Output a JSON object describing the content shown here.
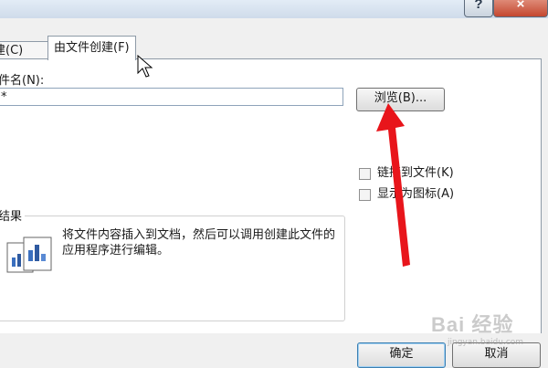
{
  "titlebar": {
    "help_icon": "?",
    "close_icon": "×"
  },
  "tabs": [
    {
      "label": "建(C)"
    },
    {
      "label": "由文件创建(F)",
      "active": true
    }
  ],
  "form": {
    "filename_label": "件名(N):",
    "filename_value": "*",
    "browse_label": "浏览(B)...",
    "link_label": "链接到文件(K)",
    "icon_label": "显示为图标(A)"
  },
  "result": {
    "label": "结果",
    "description": "将文件内容插入到文档，然后可以调用创建此文件的应用程序进行编辑。"
  },
  "footer": {
    "ok_label": "确定",
    "cancel_label": "取消"
  },
  "watermark": {
    "brand": "Bai 经验",
    "url": "jingyan.baidu.com"
  },
  "colors": {
    "arrow": "#e8151b",
    "close_button": "#c4472f"
  }
}
